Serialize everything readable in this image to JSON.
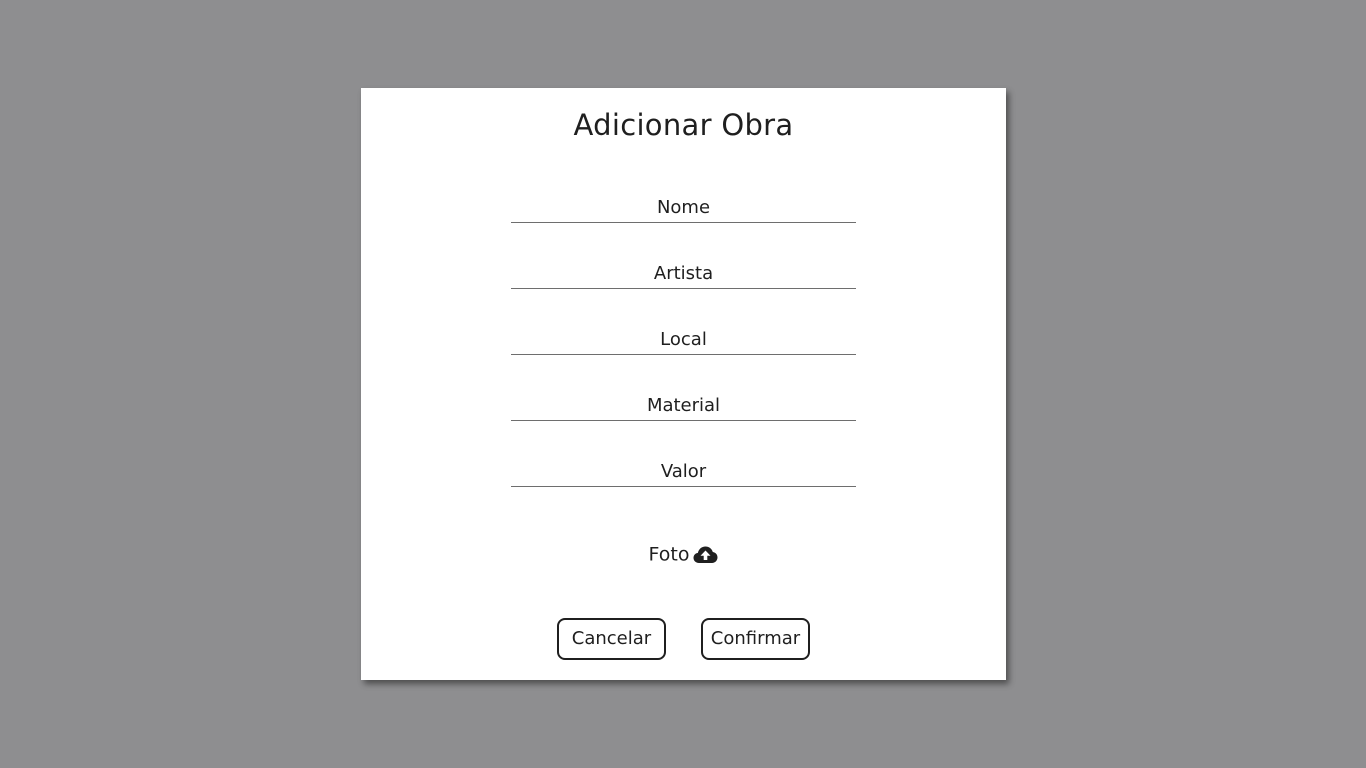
{
  "modal": {
    "title": "Adicionar Obra",
    "fields": [
      {
        "name": "nome",
        "placeholder": "Nome",
        "value": ""
      },
      {
        "name": "artista",
        "placeholder": "Artista",
        "value": ""
      },
      {
        "name": "local",
        "placeholder": "Local",
        "value": ""
      },
      {
        "name": "material",
        "placeholder": "Material",
        "value": ""
      },
      {
        "name": "valor",
        "placeholder": "Valor",
        "value": ""
      }
    ],
    "photo": {
      "label": "Foto",
      "icon": "cloud-upload-icon"
    },
    "buttons": {
      "cancel_label": "Cancelar",
      "confirm_label": "Confirmar"
    }
  },
  "colors": {
    "backdrop": "#8e8e90",
    "modal_background": "#ffffff",
    "text": "#1f1f1f",
    "underline": "#6e6e6e"
  }
}
